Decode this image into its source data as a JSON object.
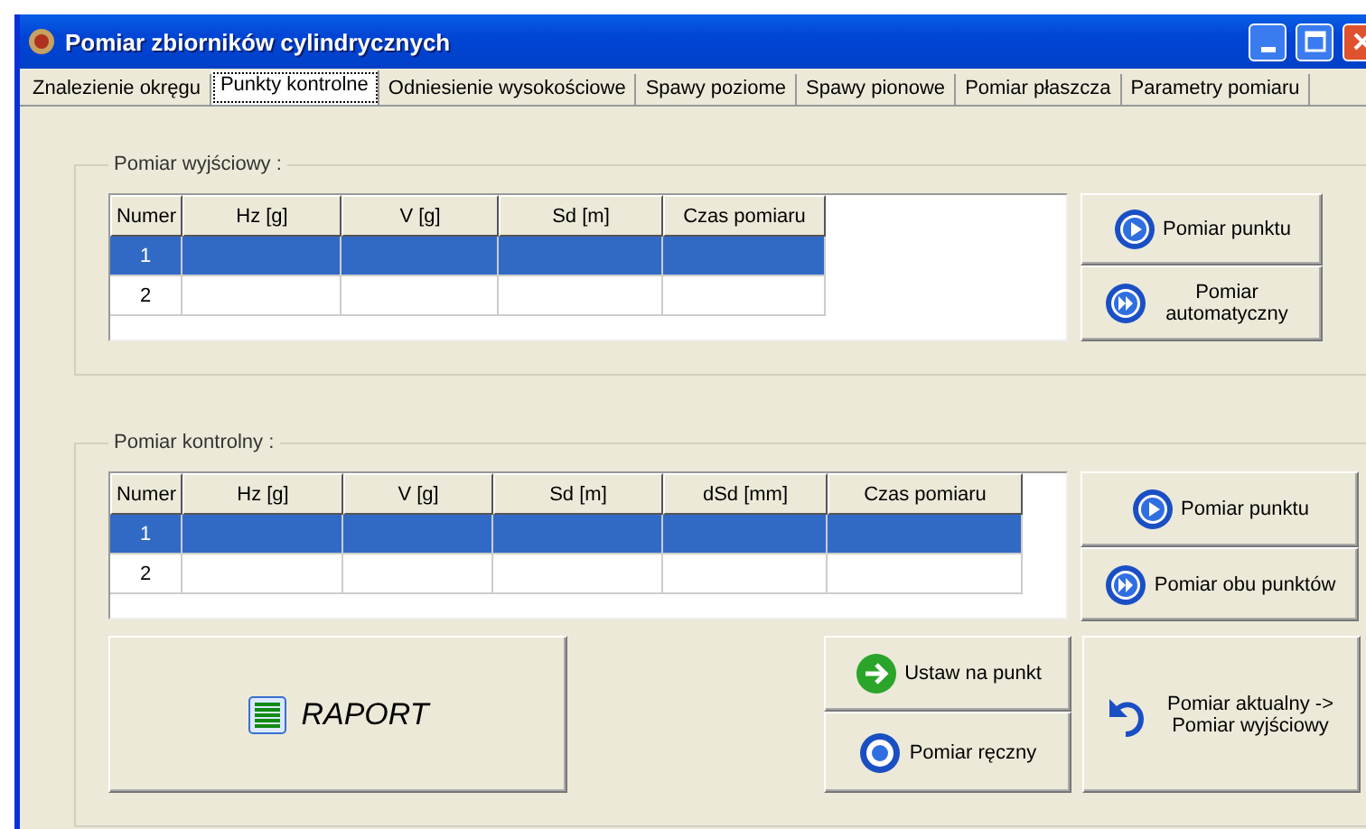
{
  "window": {
    "title": "Pomiar zbiorników cylindrycznych"
  },
  "tabs": [
    {
      "label": "Znalezienie okręgu",
      "selected": false
    },
    {
      "label": "Punkty kontrolne",
      "selected": true
    },
    {
      "label": "Odniesienie wysokościowe",
      "selected": false
    },
    {
      "label": "Spawy poziome",
      "selected": false
    },
    {
      "label": "Spawy pionowe",
      "selected": false
    },
    {
      "label": "Pomiar płaszcza",
      "selected": false
    },
    {
      "label": "Parametry pomiaru",
      "selected": false
    }
  ],
  "groups": [
    {
      "title": "Pomiar wyjściowy :",
      "columns": [
        "Numer",
        "Hz [g]",
        "V [g]",
        "Sd [m]",
        "Czas pomiaru"
      ],
      "rows": [
        {
          "number": "1",
          "selected": true
        },
        {
          "number": "2",
          "selected": false
        }
      ],
      "buttons": [
        "Pomiar punktu",
        "Pomiar automatyczny"
      ]
    },
    {
      "title": "Pomiar kontrolny :",
      "columns": [
        "Numer",
        "Hz [g]",
        "V [g]",
        "Sd [m]",
        "dSd [mm]",
        "Czas pomiaru"
      ],
      "rows": [
        {
          "number": "1",
          "selected": true
        },
        {
          "number": "2",
          "selected": false
        }
      ],
      "buttons": [
        "Pomiar punktu",
        "Pomiar obu punktów"
      ],
      "report_button": "RAPORT",
      "set_buttons": [
        "Ustaw na punkt",
        "Pomiar ręczny"
      ],
      "swap_button": "Pomiar aktualny -> Pomiar wyjściowy"
    }
  ]
}
